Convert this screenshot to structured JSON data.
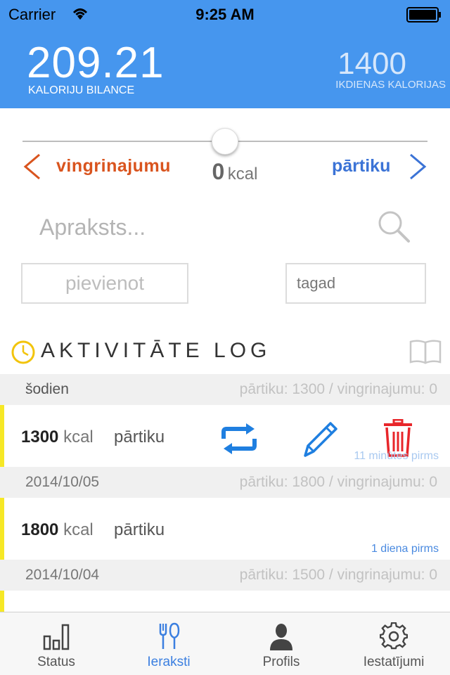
{
  "status_bar": {
    "carrier": "Carrier",
    "time": "9:25 AM"
  },
  "header": {
    "balance_value": "209.21",
    "balance_label": "KALORIJU BILANCE",
    "daily_value": "1400",
    "daily_label": "IKDIENAS KALORIJAS"
  },
  "entry": {
    "exercise_label": "vingrinajumu",
    "food_label": "pārtiku",
    "kcal_value": "0",
    "kcal_unit": "kcal",
    "slider_position": 0.5,
    "description_placeholder": "Apraksts...",
    "add_label": "pievienot",
    "time_value": "tagad"
  },
  "log": {
    "title": "AKTIVITĀTE LOG",
    "days": [
      {
        "date": "šodien",
        "summary": "pārtiku: 1300 / vingrinajumu: 0",
        "entry": {
          "kcal": "1300",
          "unit": "kcal",
          "type": "pārtiku",
          "ago": "11 minūtes pirms"
        }
      },
      {
        "date": "2014/10/05",
        "summary": "pārtiku: 1800 / vingrinajumu: 0",
        "entry": {
          "kcal": "1800",
          "unit": "kcal",
          "type": "pārtiku",
          "ago": "1 diena pirms"
        }
      },
      {
        "date": "2014/10/04",
        "summary": "pārtiku: 1500 / vingrinajumu: 0"
      }
    ]
  },
  "tabs": [
    {
      "label": "Status",
      "icon": "bar-chart-icon"
    },
    {
      "label": "Ieraksti",
      "icon": "fork-knife-icon",
      "active": true
    },
    {
      "label": "Profils",
      "icon": "person-icon"
    },
    {
      "label": "Iestatījumi",
      "icon": "gear-icon"
    }
  ],
  "colors": {
    "header_blue": "#4696ee",
    "exercise_orange": "#d9541e",
    "food_blue": "#3b73d6",
    "row_accent_yellow": "#f6e826",
    "delete_red": "#e8262a",
    "tab_active": "#3b7fe0"
  }
}
